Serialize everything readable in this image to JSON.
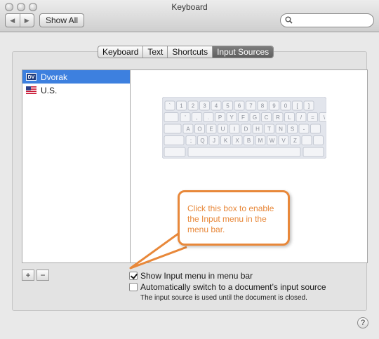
{
  "window": {
    "title": "Keyboard"
  },
  "toolbar": {
    "back_glyph": "◀",
    "forward_glyph": "▶",
    "show_all_label": "Show All",
    "search_placeholder": "",
    "search_icon": "search-icon"
  },
  "tabs": [
    {
      "label": "Keyboard",
      "active": false
    },
    {
      "label": "Text",
      "active": false
    },
    {
      "label": "Shortcuts",
      "active": false
    },
    {
      "label": "Input Sources",
      "active": true
    }
  ],
  "input_sources": [
    {
      "badge": "DV",
      "label": "Dvorak",
      "selected": true
    },
    {
      "badge": "us-flag",
      "label": "U.S.",
      "selected": false
    }
  ],
  "keyboard_rows": [
    [
      "`",
      "1",
      "2",
      "3",
      "4",
      "5",
      "6",
      "7",
      "8",
      "9",
      "0",
      "[",
      "]"
    ],
    [
      "'",
      ",",
      ".",
      "P",
      "Y",
      "F",
      "G",
      "C",
      "R",
      "L",
      "/",
      "=",
      "\\"
    ],
    [
      "A",
      "O",
      "E",
      "U",
      "I",
      "D",
      "H",
      "T",
      "N",
      "S",
      "-"
    ],
    [
      ";",
      "Q",
      "J",
      "K",
      "X",
      "B",
      "M",
      "W",
      "V",
      "Z"
    ]
  ],
  "list_buttons": {
    "add": "+",
    "remove": "−"
  },
  "options": {
    "show_menu": {
      "label": "Show Input menu in menu bar",
      "checked": true
    },
    "auto_switch": {
      "label": "Automatically switch to a document’s input source",
      "checked": false
    },
    "note": "The input source is used until the document is closed."
  },
  "callout": {
    "text": "Click this box to enable the Input menu in the menu bar."
  },
  "help": {
    "label": "?"
  },
  "colors": {
    "selection": "#3d80df",
    "callout_accent": "#e8883a"
  }
}
